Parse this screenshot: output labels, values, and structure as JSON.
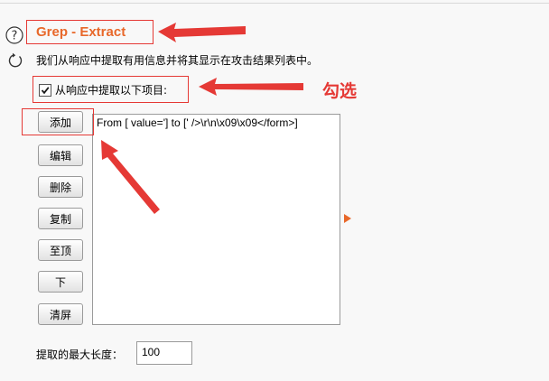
{
  "section": {
    "title": "Grep - Extract",
    "description": "我们从响应中提取有用信息并将其显示在攻击结果列表中。"
  },
  "extract_option": {
    "label": "从响应中提取以下项目:",
    "checked": true
  },
  "buttons": {
    "add": "添加",
    "edit": "编辑",
    "remove": "删除",
    "duplicate": "复制",
    "to_top": "至顶",
    "down": "下",
    "clear": "清屏"
  },
  "extract_list": [
    "From [ value='] to [' />\\r\\n\\x09\\x09</form>]"
  ],
  "max_length": {
    "label": "提取的最大长度：",
    "value": "100"
  },
  "annotation": {
    "text": "勾选",
    "color": "#e53935"
  },
  "colors": {
    "title": "#e8682a",
    "background": "#f8f8f8"
  },
  "icons": [
    "help-icon",
    "refresh-icon",
    "checkmark-icon",
    "expand-arrow-icon"
  ]
}
